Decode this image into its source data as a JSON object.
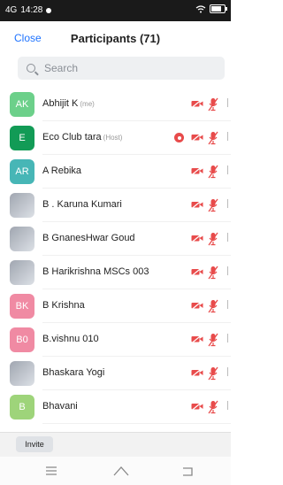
{
  "status": {
    "time": "14:28",
    "network": "4G"
  },
  "header": {
    "close_label": "Close",
    "title": "Participants (71)"
  },
  "search": {
    "placeholder": "Search"
  },
  "participants": [
    {
      "initials": "AK",
      "name": "Abhijit K",
      "tag": "(me)",
      "color": "#6cd08a",
      "photo": false
    },
    {
      "initials": "E",
      "name": "Eco Club tara",
      "tag": "(Host)",
      "color": "#129b56",
      "photo": false
    },
    {
      "initials": "AR",
      "name": "A Rebika",
      "tag": "",
      "color": "#47b6b6",
      "photo": false
    },
    {
      "initials": "",
      "name": "B . Karuna Kumari",
      "tag": "",
      "color": "#9aa2ab",
      "photo": true
    },
    {
      "initials": "",
      "name": "B GnanesHwar Goud",
      "tag": "",
      "color": "#9aa2ab",
      "photo": true
    },
    {
      "initials": "",
      "name": "B Harikrishna MSCs 003",
      "tag": "",
      "color": "#9aa2ab",
      "photo": true
    },
    {
      "initials": "BK",
      "name": "B Krishna",
      "tag": "",
      "color": "#f08aa3",
      "photo": false
    },
    {
      "initials": "B0",
      "name": "B.vishnu 010",
      "tag": "",
      "color": "#f08aa3",
      "photo": false
    },
    {
      "initials": "",
      "name": "Bhaskara Yogi",
      "tag": "",
      "color": "#9aa2ab",
      "photo": true
    },
    {
      "initials": "B",
      "name": "Bhavani",
      "tag": "",
      "color": "#9ed47a",
      "photo": false
    }
  ],
  "footer": {
    "invite_label": "Invite"
  },
  "colors": {
    "accent": "#1e73ff",
    "mute_red": "#e84b4b"
  },
  "icons": [
    "search-icon",
    "camera-off-icon",
    "mic-off-icon",
    "recording-icon",
    "menu-icon",
    "home-icon",
    "back-icon"
  ]
}
